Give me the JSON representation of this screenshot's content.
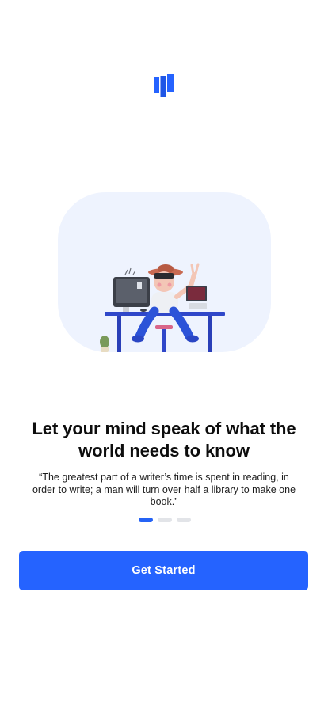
{
  "brand": {
    "logo_icon": "bookshelf-logo-icon",
    "accent": "#2563ff"
  },
  "illustration": {
    "subject": "person-at-desk-illustration",
    "background": "#eef3fe"
  },
  "onboarding": {
    "headline": "Let your mind speak of what the world needs to know",
    "quote": "“The greatest part of a writer’s time is spent in reading, in order to write; a man will turn over half a library to make one book.”",
    "pager": {
      "total": 3,
      "active": 1
    }
  },
  "actions": {
    "get_started_label": "Get Started"
  }
}
